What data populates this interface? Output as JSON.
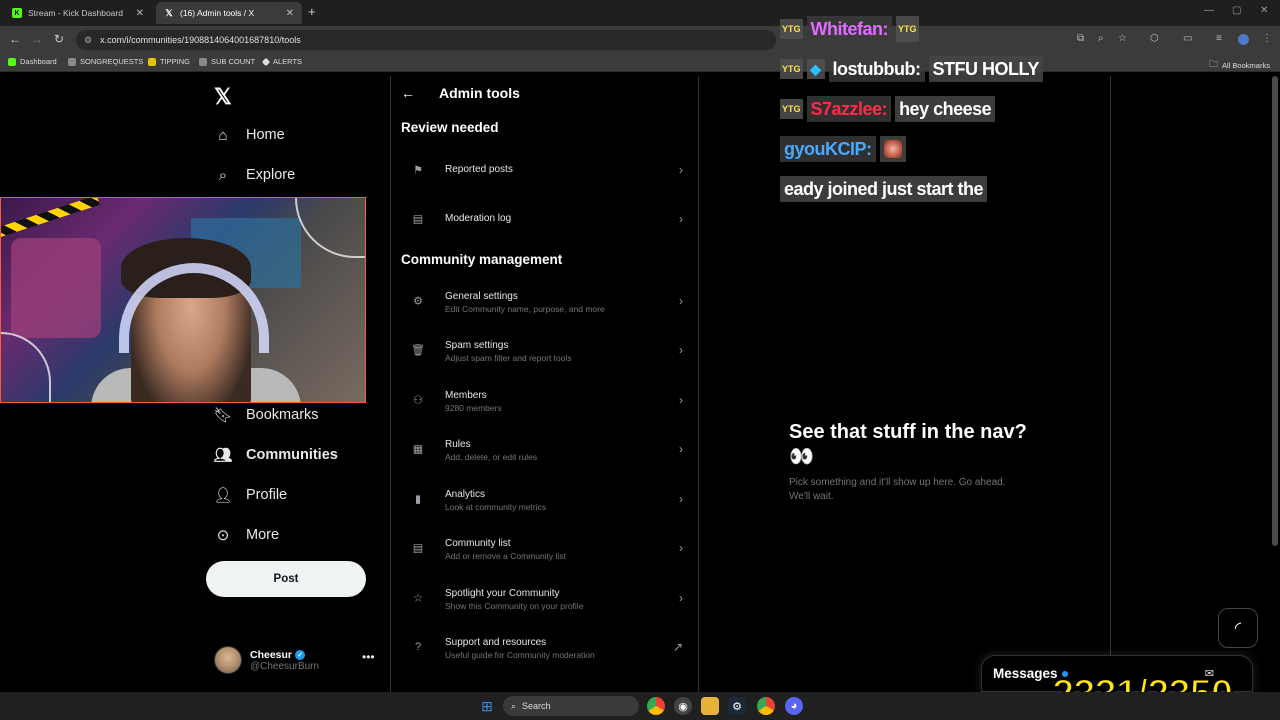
{
  "browser": {
    "tabs": [
      {
        "title": "Stream - Kick Dashboard",
        "favicon": "kick-icon",
        "active": false
      },
      {
        "title": "(16) Admin tools / X",
        "favicon": "x-logo-icon",
        "active": true
      }
    ],
    "url": "x.com/i/communities/1908814064001687810/tools",
    "bookmarks": [
      "Dashboard",
      "SONGREQUESTS",
      "TIPPING",
      "SUB COUNT",
      "ALERTS"
    ],
    "all_bookmarks": "All Bookmarks"
  },
  "nav": {
    "items": [
      {
        "label": "Home",
        "icon": "home-icon"
      },
      {
        "label": "Explore",
        "icon": "search-icon"
      },
      {
        "label": "Bookmarks",
        "icon": "bookmark-icon"
      },
      {
        "label": "Communities",
        "icon": "communities-icon",
        "active": true
      },
      {
        "label": "Profile",
        "icon": "person-icon"
      },
      {
        "label": "More",
        "icon": "more-circle-icon"
      }
    ],
    "post_label": "Post",
    "profile": {
      "name": "Cheesur",
      "handle": "@CheesurBurn"
    }
  },
  "admin": {
    "title": "Admin tools",
    "review_heading": "Review needed",
    "review_items": [
      {
        "title": "Reported posts",
        "subtitle": ""
      },
      {
        "title": "Moderation log",
        "subtitle": ""
      }
    ],
    "management_heading": "Community management",
    "management_items": [
      {
        "title": "General settings",
        "subtitle": "Edit Community name, purpose, and more"
      },
      {
        "title": "Spam settings",
        "subtitle": "Adjust spam filter and report tools"
      },
      {
        "title": "Members",
        "subtitle": "9280 members"
      },
      {
        "title": "Rules",
        "subtitle": "Add, delete, or edit rules"
      },
      {
        "title": "Analytics",
        "subtitle": "Look at community metrics"
      },
      {
        "title": "Community list",
        "subtitle": "Add or remove a Community list"
      },
      {
        "title": "Spotlight your Community",
        "subtitle": "Show this Community on your profile"
      },
      {
        "title": "Support and resources",
        "subtitle": "Useful guide for Community moderation"
      }
    ]
  },
  "detail": {
    "title": "See that stuff in the nav? 👀",
    "subtitle": "Pick something and it'll show up here. Go ahead. We'll wait."
  },
  "chat": [
    {
      "badge": "YTG",
      "name": "Whitefan:",
      "message": "",
      "name_color": "#e36bff"
    },
    {
      "badge": "YTG",
      "name": "lostubbub:",
      "message": "STFU HOLLY",
      "name_color": "#ffffff"
    },
    {
      "badge": "YTG",
      "name": "S7azzlee:",
      "message": "hey cheese",
      "name_color": "#ff2a4a"
    },
    {
      "badge": "",
      "name": "gyouKCIP:",
      "message": "",
      "name_color": "#4aa8ff"
    },
    {
      "badge": "",
      "name": "",
      "message": "eady joined just start the",
      "name_color": "#ffffff"
    }
  ],
  "messages": {
    "label": "Messages"
  },
  "counter": "2331/2350",
  "taskbar": {
    "search_placeholder": "Search"
  },
  "colors": {
    "accent": "#1d9bf0",
    "counter": "#ffe41c",
    "kick": "#53fc18"
  }
}
